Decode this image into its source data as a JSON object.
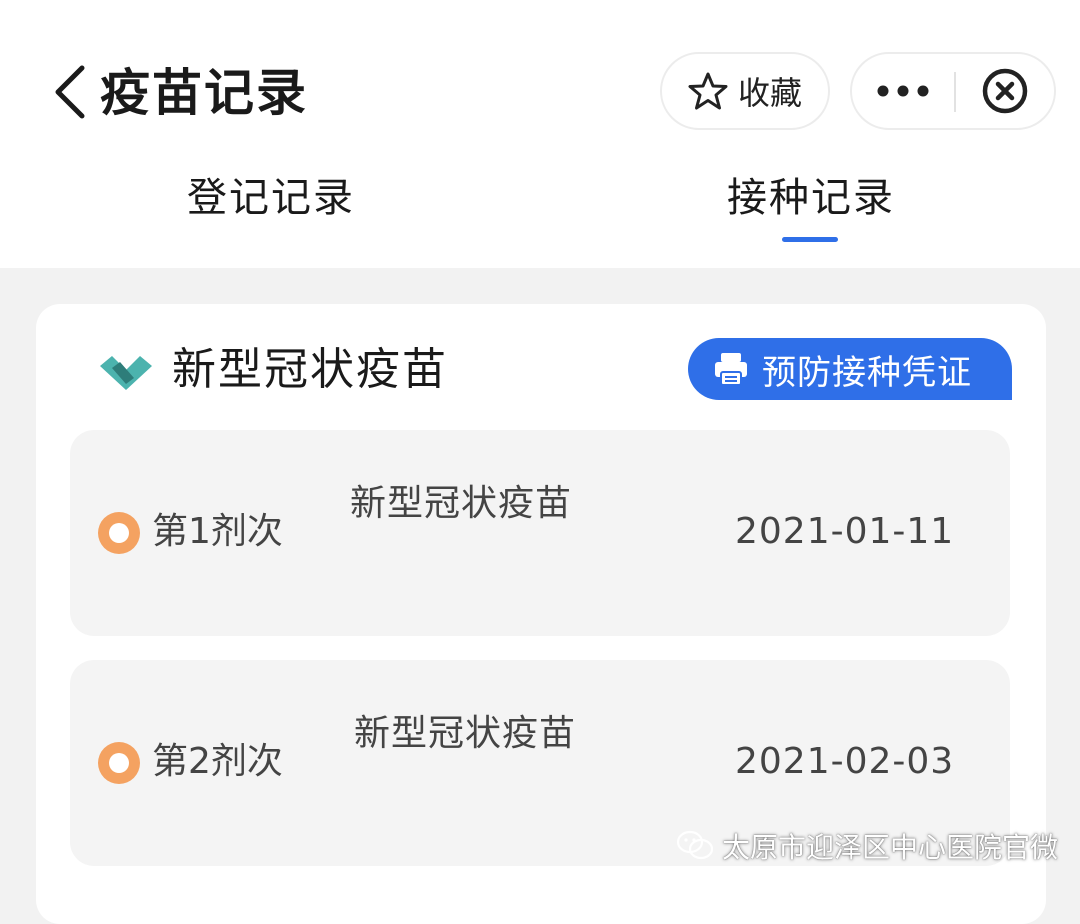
{
  "header": {
    "title": "疫苗记录",
    "favorite_label": "收藏",
    "icons": {
      "back": "chevron-left-icon",
      "favorite": "star-icon",
      "more": "ellipsis-icon",
      "close": "close-circle-icon"
    }
  },
  "tabs": [
    {
      "label": "登记记录",
      "active": false
    },
    {
      "label": "接种记录",
      "active": true
    }
  ],
  "record": {
    "title": "新型冠状疫苗",
    "cert_button_label": "预防接种凭证",
    "doses": [
      {
        "label": "第1剂次",
        "vaccine": "新型冠状疫苗",
        "date": "2021-01-11"
      },
      {
        "label": "第2剂次",
        "vaccine": "新型冠状疫苗",
        "date": "2021-02-03"
      }
    ]
  },
  "watermark": {
    "text": "太原市迎泽区中心医院官微",
    "icon": "wechat-icon"
  },
  "colors": {
    "accent": "#2f6fe8",
    "dose_dot": "#f4a261",
    "logo_teal": "#4cb3ae",
    "logo_dark": "#2e7d7a"
  }
}
